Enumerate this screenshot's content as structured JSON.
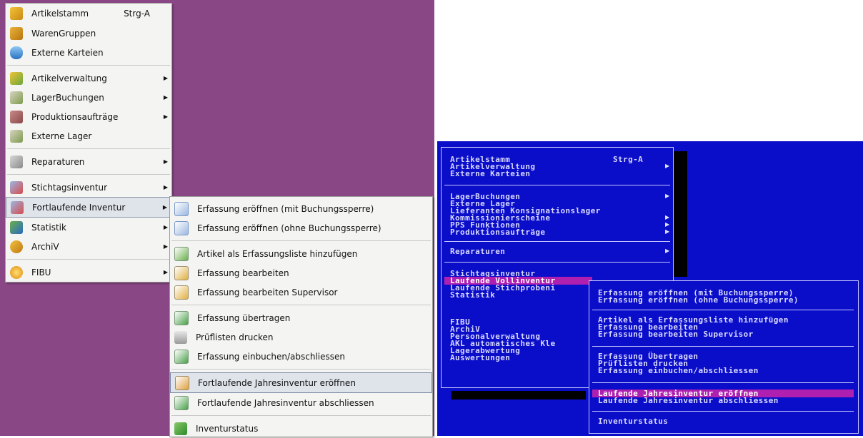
{
  "gui": {
    "main_menu": [
      {
        "label": "Artikelstamm",
        "shortcut": "Strg-A",
        "icon": "box-icon"
      },
      {
        "label": "WarenGruppen",
        "icon": "boxes-icon"
      },
      {
        "label": "Externe Karteien",
        "icon": "database-icon"
      },
      {
        "label": "Artikelverwaltung",
        "icon": "shield-icon"
      },
      {
        "label": "LagerBuchungen",
        "icon": "warehouse-icon"
      },
      {
        "label": "Produktionsaufträge",
        "icon": "factory-icon"
      },
      {
        "label": "Externe Lager",
        "icon": "warehouse-icon"
      },
      {
        "label": "Reparaturen",
        "icon": "wrench-icon"
      },
      {
        "label": "Stichtagsinventur",
        "icon": "checklist-icon"
      },
      {
        "label": "Fortlaufende Inventur",
        "icon": "checklist-icon"
      },
      {
        "label": "Statistik",
        "icon": "chart-icon"
      },
      {
        "label": "ArchiV",
        "icon": "archive-icon"
      },
      {
        "label": "FIBU",
        "icon": "coin-icon"
      }
    ],
    "sub_menu": [
      "Erfassung eröffnen (mit Buchungssperre)",
      "Erfassung eröffnen (ohne Buchungssperre)",
      "Artikel als Erfassungsliste hinzufügen",
      "Erfassung bearbeiten",
      "Erfassung bearbeiten Supervisor",
      "Erfassung übertragen",
      "Prüflisten drucken",
      "Erfassung einbuchen/abschliessen",
      "Fortlaufende Jahresinventur eröffnen",
      "Fortlaufende Jahresinventur abschliessen",
      "Inventurstatus"
    ],
    "colors": {
      "desktop": "#8a4785",
      "menu": "#f4f4f2",
      "highlight": "#dfe3ea"
    }
  },
  "dos": {
    "main_menu": [
      "Artikelstamm",
      "Artikelverwaltung",
      "Externe Karteien",
      "LagerBuchungen",
      "Externe Lager",
      "Lieferanten Konsignationslager",
      "Kommissionierscheine",
      "PPS Funktionen",
      "Produktionsaufträge",
      "Reparaturen",
      "Stichtagsinventur",
      "Laufende Vollinventur",
      "Laufende Stichprobeni",
      "Statistik",
      "FIBU",
      "ArchiV",
      "Personalverwaltung",
      "AKL automatisches Kle",
      "Lagerabwertung",
      "Auswertungen"
    ],
    "shortcut": "Strg-A",
    "sub_menu": [
      "Erfassung eröffnen (mit Buchungssperre)",
      "Erfassung eröffnen (ohne Buchungssperre)",
      "Artikel als Erfassungsliste hinzufügen",
      "Erfassung bearbeiten",
      "Erfassung bearbeiten Supervisor",
      "Erfassung Übertragen",
      "Prüflisten drucken",
      "Erfassung einbuchen/abschliessen",
      "Laufende Jahresinventur eröffnen",
      "Laufende Jahresinventur abschliessen",
      "Inventurstatus"
    ],
    "colors": {
      "background": "#0a0ec8",
      "selection": "#b020b0",
      "text": "#d8d8ff"
    }
  }
}
